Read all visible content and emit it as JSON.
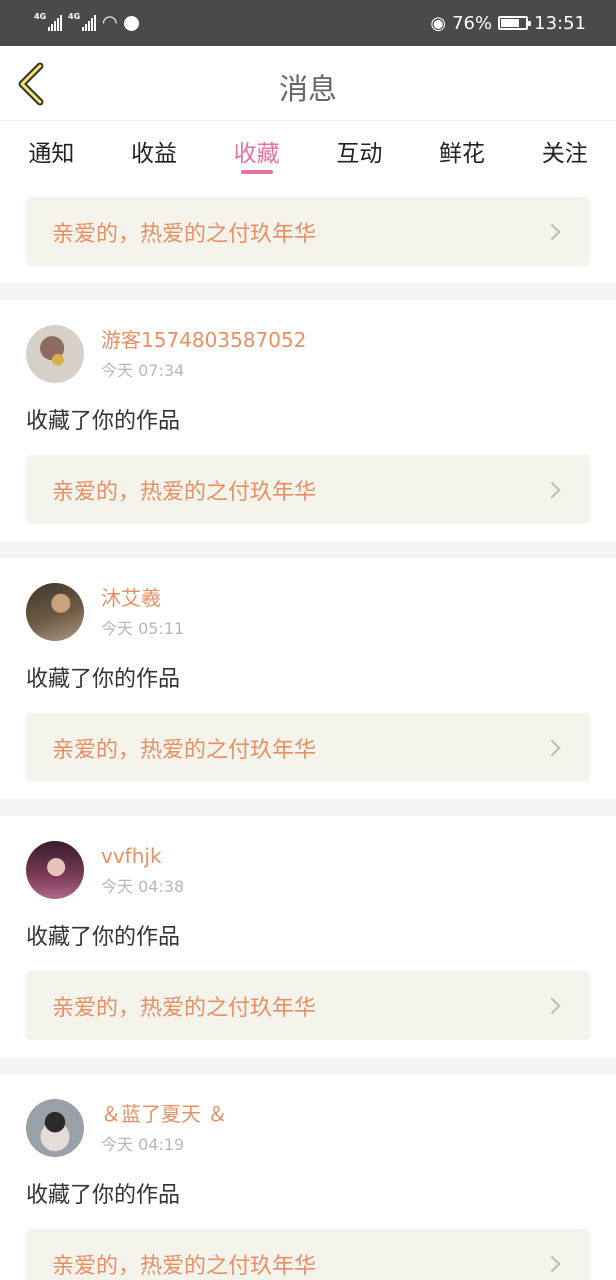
{
  "status_bar": {
    "signal1": "4G",
    "signal2": "4G",
    "battery": "76%",
    "time": "13:51"
  },
  "header": {
    "title": "消息",
    "back_icon": "chevron-left-icon"
  },
  "tabs": [
    {
      "label": "通知",
      "active": false
    },
    {
      "label": "收益",
      "active": false
    },
    {
      "label": "收藏",
      "active": true
    },
    {
      "label": "互动",
      "active": false
    },
    {
      "label": "鲜花",
      "active": false
    },
    {
      "label": "关注",
      "active": false
    }
  ],
  "colors": {
    "accent": "#e2739c",
    "name": "#e89063",
    "work_bg": "#f4f4ec"
  },
  "top_work": "亲爱的，热爱的之付玖年华",
  "items": [
    {
      "username": "游客1574803587052",
      "time": "今天 07:34",
      "action": "收藏了你的作品",
      "work": "亲爱的，热爱的之付玖年华"
    },
    {
      "username": "沐艾羲",
      "time": "今天 05:11",
      "action": "收藏了你的作品",
      "work": "亲爱的，热爱的之付玖年华"
    },
    {
      "username": "vvfhjk",
      "time": "今天 04:38",
      "action": "收藏了你的作品",
      "work": "亲爱的，热爱的之付玖年华"
    },
    {
      "username": "＆蓝了夏天 ＆",
      "time": "今天 04:19",
      "action": "收藏了你的作品",
      "work": "亲爱的，热爱的之付玖年华"
    }
  ]
}
